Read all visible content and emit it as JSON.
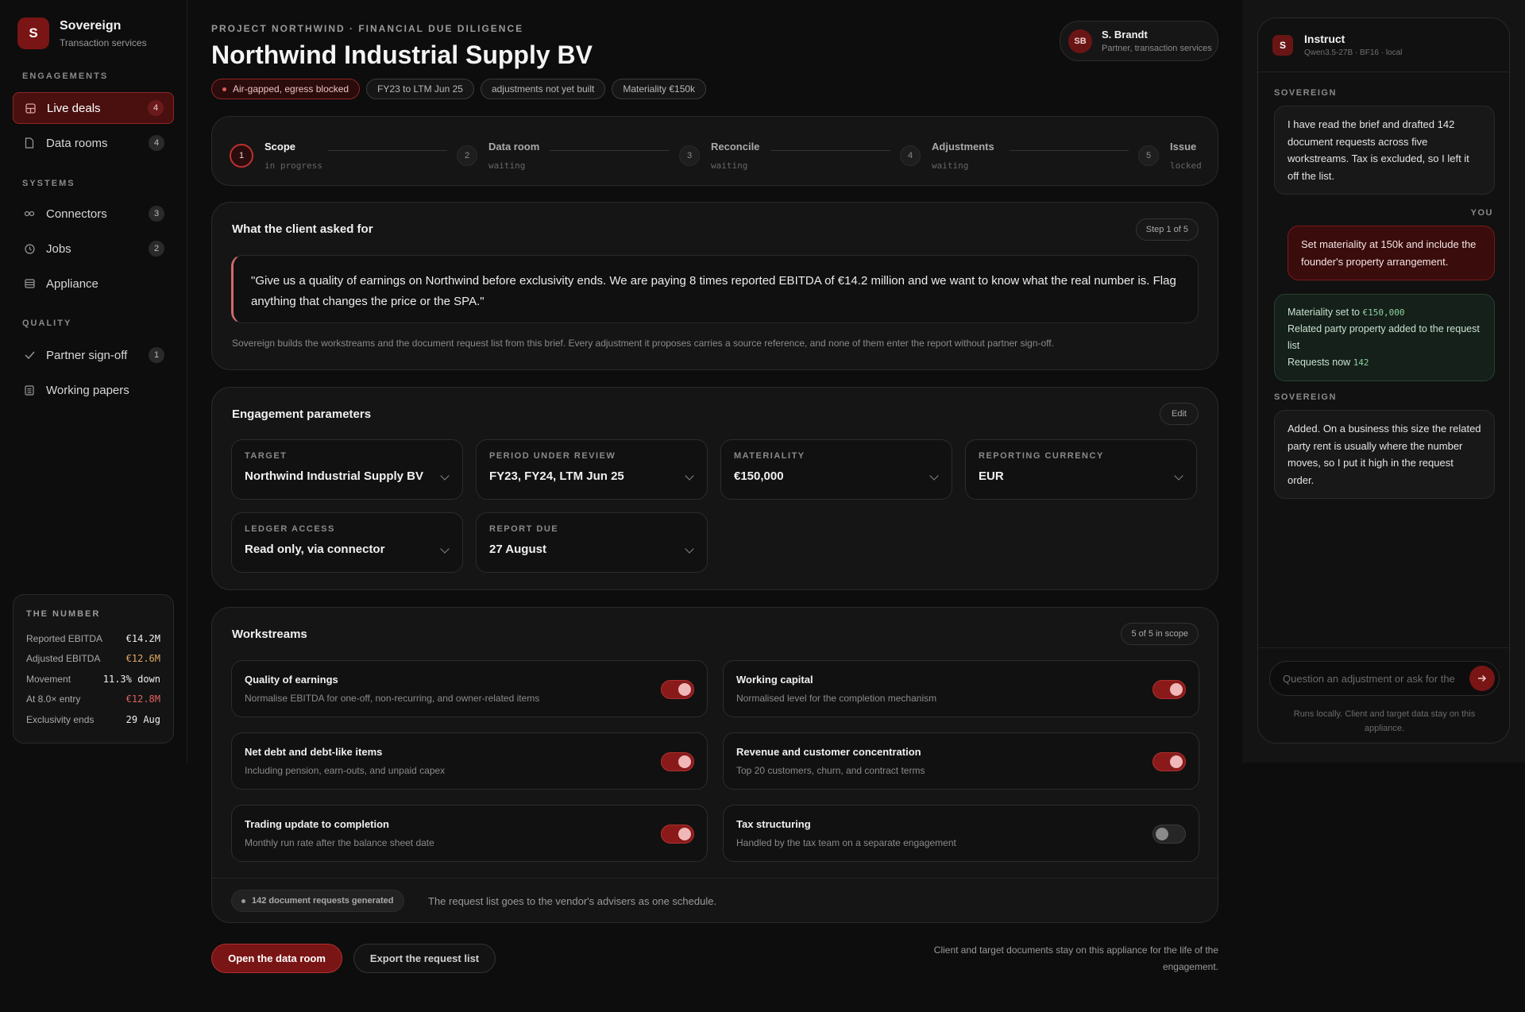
{
  "brand": {
    "mark": "S",
    "name": "Sovereign",
    "subtitle": "Transaction services"
  },
  "sidebar": {
    "engagements_label": "ENGAGEMENTS",
    "systems_label": "SYSTEMS",
    "quality_label": "QUALITY",
    "items": [
      {
        "label": "Live deals",
        "count": "4",
        "icon": "grid-icon"
      },
      {
        "label": "Data rooms",
        "count": "4",
        "icon": "document-icon"
      },
      {
        "label": "Connectors",
        "count": "3",
        "icon": "link-icon"
      },
      {
        "label": "Jobs",
        "count": "2",
        "icon": "clock-icon"
      },
      {
        "label": "Appliance",
        "count": "",
        "icon": "server-icon"
      },
      {
        "label": "Partner sign-off",
        "count": "1",
        "icon": "check-icon"
      },
      {
        "label": "Working papers",
        "count": "",
        "icon": "sheet-icon"
      }
    ]
  },
  "the_number": {
    "title": "THE NUMBER",
    "rows": [
      {
        "label": "Reported EBITDA",
        "value": "€14.2M"
      },
      {
        "label": "Adjusted EBITDA",
        "value": "€12.6M"
      },
      {
        "label": "Movement",
        "value": "11.3% down"
      },
      {
        "label": "At 8.0× entry",
        "value": "€12.8M"
      },
      {
        "label": "Exclusivity ends",
        "value": "29 Aug"
      }
    ]
  },
  "header": {
    "eyebrow": "PROJECT NORTHWIND · FINANCIAL DUE DILIGENCE",
    "title": "Northwind Industrial Supply BV",
    "chips": [
      "Air-gapped, egress blocked",
      "FY23 to LTM Jun 25",
      "adjustments not yet built",
      "Materiality €150k"
    ]
  },
  "user": {
    "initials": "SB",
    "name": "S. Brandt",
    "role": "Partner, transaction services"
  },
  "steps": [
    {
      "num": "1",
      "name": "Scope",
      "status": "in progress"
    },
    {
      "num": "2",
      "name": "Data room",
      "status": "waiting"
    },
    {
      "num": "3",
      "name": "Reconcile",
      "status": "waiting"
    },
    {
      "num": "4",
      "name": "Adjustments",
      "status": "waiting"
    },
    {
      "num": "5",
      "name": "Issue",
      "status": "locked"
    }
  ],
  "asked": {
    "title": "What the client asked for",
    "badge": "Step 1 of 5",
    "quote": "\"Give us a quality of earnings on Northwind before exclusivity ends. We are paying 8 times reported EBITDA of €14.2 million and we want to know what the real number is. Flag anything that changes the price or the SPA.\"",
    "note": "Sovereign builds the workstreams and the document request list from this brief. Every adjustment it proposes carries a source reference, and none of them enter the report without partner sign-off."
  },
  "params": {
    "title": "Engagement parameters",
    "edit_label": "Edit",
    "fields": [
      {
        "label": "TARGET",
        "value": "Northwind Industrial Supply BV"
      },
      {
        "label": "PERIOD UNDER REVIEW",
        "value": "FY23, FY24, LTM Jun 25"
      },
      {
        "label": "MATERIALITY",
        "value": "€150,000"
      },
      {
        "label": "REPORTING CURRENCY",
        "value": "EUR"
      },
      {
        "label": "LEDGER ACCESS",
        "value": "Read only, via connector"
      },
      {
        "label": "REPORT DUE",
        "value": "27 August"
      }
    ]
  },
  "workstreams": {
    "title": "Workstreams",
    "badge": "5 of 5 in scope",
    "items": [
      {
        "title": "Quality of earnings",
        "desc": "Normalise EBITDA for one-off, non-recurring, and owner-related items",
        "on": true
      },
      {
        "title": "Working capital",
        "desc": "Normalised level for the completion mechanism",
        "on": true
      },
      {
        "title": "Net debt and debt-like items",
        "desc": "Including pension, earn-outs, and unpaid capex",
        "on": true
      },
      {
        "title": "Revenue and customer concentration",
        "desc": "Top 20 customers, churn, and contract terms",
        "on": true
      },
      {
        "title": "Trading update to completion",
        "desc": "Monthly run rate after the balance sheet date",
        "on": true
      },
      {
        "title": "Tax structuring",
        "desc": "Handled by the tax team on a separate engagement",
        "on": false
      }
    ],
    "generated": "142 document requests generated",
    "generated_note": "The request list goes to the vendor's advisers as one schedule."
  },
  "actions": {
    "primary": "Open the data room",
    "secondary": "Export the request list",
    "note": "Client and target documents stay on this appliance for the life of the engagement."
  },
  "chat": {
    "mark": "S",
    "title": "Instruct",
    "subtitle": "Qwen3.5-27B · BF16 · local",
    "bot_label": "SOVEREIGN",
    "you_label": "YOU",
    "msg1": "I have read the brief and drafted 142 document requests across five workstreams. Tax is excluded, so I left it off the list.",
    "msg2": "Set materiality at 150k and include the founder's property arrangement.",
    "sys_line1_prefix": "Materiality set to ",
    "sys_line1_value": "€150,000",
    "sys_line2": "Related party property added to the request list",
    "sys_line3_prefix": "Requests now ",
    "sys_line3_value": "142",
    "msg3": "Added. On a business this size the related party rent is usually where the number moves, so I put it high in the request order.",
    "input_placeholder": "Question an adjustment or ask for the",
    "footer_note": "Runs locally. Client and target data stay on this appliance."
  }
}
